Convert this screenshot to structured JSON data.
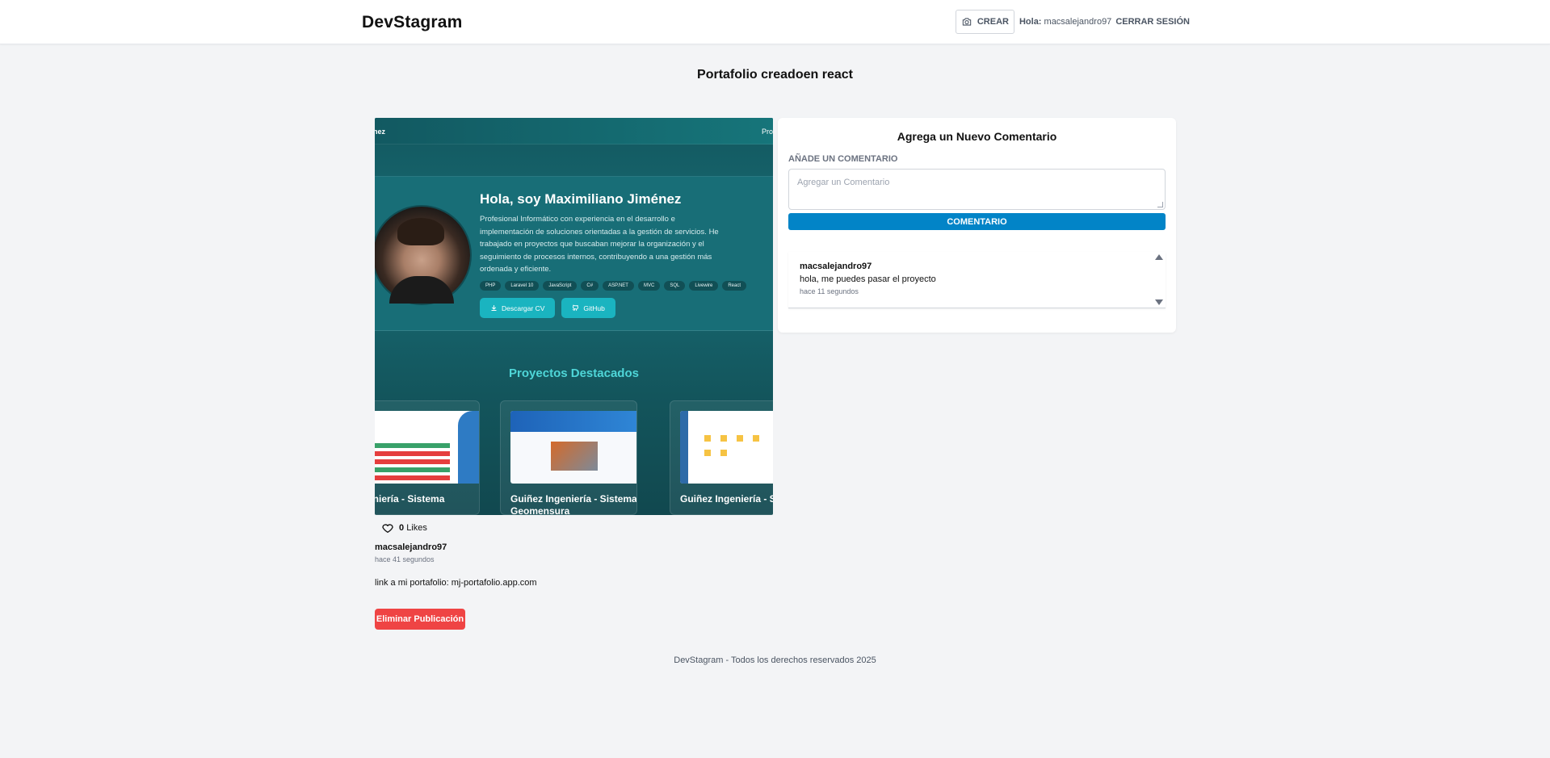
{
  "header": {
    "logo": "DevStagram",
    "create_label": "CREAR",
    "greeting_prefix": "Hola:",
    "username": "macsalejandro97",
    "logout_label": "CERRAR SESIÓN"
  },
  "post": {
    "title": "Portafolio creadoen react",
    "likes_count": "0",
    "likes_label": "Likes",
    "author": "macsalejandro97",
    "time_ago": "hace 41 segundos",
    "description": "link a mi portafolio: mj-portafolio.app.com",
    "delete_label": "Eliminar Publicación",
    "image": {
      "nav_left": "nez",
      "nav_right": "Pro",
      "name": "Hola, soy Maximiliano Jiménez",
      "bio": "Profesional Informático con experiencia en el desarrollo e implementación de soluciones orientadas a la gestión de servicios. He trabajado en proyectos que buscaban mejorar la organización y el seguimiento de procesos internos, contribuyendo a una gestión más ordenada y eficiente.",
      "tags": [
        "PHP",
        "Laravel 10",
        "JavaScript",
        "C#",
        "ASP.NET",
        "MVC",
        "SQL",
        "Livewire",
        "React"
      ],
      "btn_cv": "Descargar CV",
      "btn_github": "GitHub",
      "projects_title": "Proyectos Destacados",
      "projects": [
        {
          "title": "Ingeniería - Sistema"
        },
        {
          "title": "Guiñez Ingeniería - Sistema Geomensura"
        },
        {
          "title": "Guiñez Ingeniería - S SGD"
        }
      ]
    }
  },
  "comments": {
    "panel_title": "Agrega un Nuevo Comentario",
    "field_label": "AÑADE UN COMENTARIO",
    "placeholder": "Agregar un Comentario",
    "submit_label": "COMENTARIO",
    "items": [
      {
        "user": "macsalejandro97",
        "text": "hola, me puedes pasar el proyecto",
        "time": "hace 11 segundos"
      }
    ]
  },
  "footer": {
    "text": "DevStagram - Todos los derechos reservados 2025"
  },
  "colors": {
    "accent": "#0284c7",
    "danger": "#ef4444",
    "background": "#f3f4f6"
  }
}
